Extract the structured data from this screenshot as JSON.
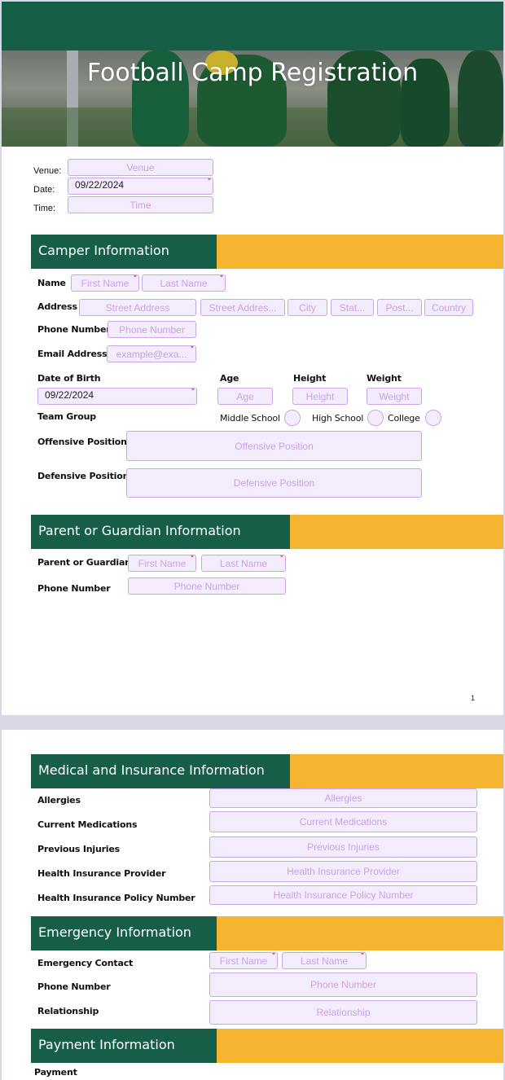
{
  "title": "Football Camp Registration",
  "colors": {
    "brand_green": "#175e48",
    "accent_gold": "#f6b531",
    "field_fill": "#f3ecfd",
    "field_border": "#c9a6ea",
    "required": "#e0304a"
  },
  "event": {
    "venue_label": "Venue:",
    "venue_placeholder": "Venue",
    "date_label": "Date:",
    "date_value": "09/22/2024",
    "time_label": "Time:",
    "time_placeholder": "Time"
  },
  "required_mark": "*",
  "camper": {
    "heading": "Camper Information",
    "name_label": "Name",
    "first_name": "First Name",
    "last_name": "Last Name",
    "address_label": "Address",
    "street1": "Street Address",
    "street2": "Street Addres...",
    "city": "City",
    "state": "Stat...",
    "postal": "Post...",
    "country": "Country",
    "phone_label": "Phone Number",
    "phone_placeholder": "Phone Number",
    "email_label": "Email Address",
    "email_placeholder": "example@exa...",
    "dob_label": "Date of Birth",
    "dob_value": "09/22/2024",
    "age_label": "Age",
    "age_placeholder": "Age",
    "height_label": "Height",
    "height_placeholder": "Height",
    "weight_label": "Weight",
    "weight_placeholder": "Weight",
    "team_group_label": "Team Group",
    "team_options": [
      "Middle School",
      "High School",
      "College"
    ],
    "offensive_label": "Offensive Position",
    "offensive_placeholder": "Offensive Position",
    "defensive_label": "Defensive Position",
    "defensive_placeholder": "Defensive Position"
  },
  "guardian": {
    "heading": "Parent or Guardian Information",
    "name_label": "Parent or Guardian",
    "first_name": "First Name",
    "last_name": "Last Name",
    "phone_label": "Phone Number",
    "phone_placeholder": "Phone Number"
  },
  "page_number": "1",
  "medical": {
    "heading": "Medical and Insurance Information",
    "fields": [
      {
        "label": "Allergies",
        "placeholder": "Allergies"
      },
      {
        "label": "Current Medications",
        "placeholder": "Current Medications"
      },
      {
        "label": "Previous Injuries",
        "placeholder": "Previous Injuries"
      },
      {
        "label": "Health Insurance Provider",
        "placeholder": "Health Insurance Provider"
      },
      {
        "label": "Health Insurance Policy Number",
        "placeholder": "Health Insurance Policy Number"
      }
    ]
  },
  "emergency": {
    "heading": "Emergency Information",
    "contact_label": "Emergency Contact",
    "first_name": "First Name",
    "last_name": "Last Name",
    "phone_label": "Phone Number",
    "phone_placeholder": "Phone Number",
    "relationship_label": "Relationship",
    "relationship_placeholder": "Relationship"
  },
  "payment": {
    "heading": "Payment Information",
    "payment_label": "Payment"
  }
}
